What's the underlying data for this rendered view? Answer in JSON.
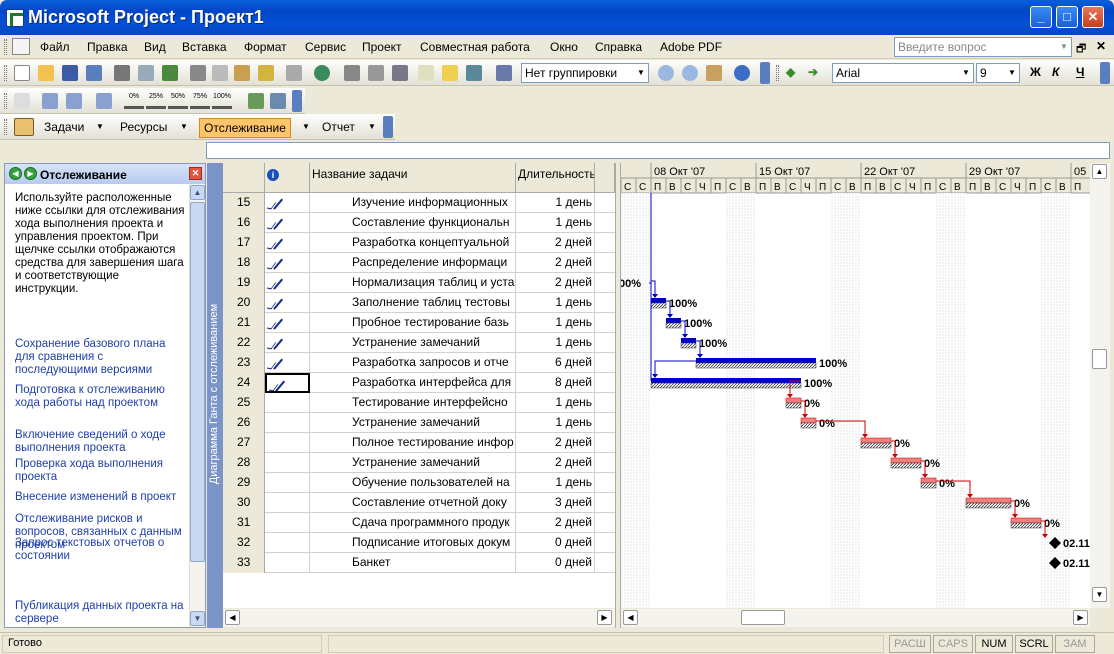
{
  "window": {
    "title": "Microsoft Project - Проект1"
  },
  "menu": {
    "items": [
      "Файл",
      "Правка",
      "Вид",
      "Вставка",
      "Формат",
      "Сервис",
      "Проект",
      "Совместная работа",
      "Окно",
      "Справка",
      "Adobe PDF"
    ],
    "help_placeholder": "Введите вопрос"
  },
  "toolbar": {
    "grouping": "Нет группировки",
    "font": "Arial",
    "font_size": "9",
    "bold": "Ж",
    "italic": "К",
    "underline": "Ч",
    "pct": [
      "0%",
      "25%",
      "50%",
      "75%",
      "100%"
    ]
  },
  "guide": {
    "tasks": "Задачи",
    "resources": "Ресурсы",
    "tracking": "Отслеживание",
    "report": "Отчет"
  },
  "taskpane": {
    "title": "Отслеживание",
    "description": "Используйте расположенные ниже ссылки для отслеживания хода выполнения проекта и управления проектом. При щелчке ссылки отображаются средства для завершения шага и соответствующие инструкции.",
    "links": [
      "Сохранение базового плана для сравнения с последующими версиями",
      "Подготовка к отслеживанию хода работы над проектом",
      "Включение сведений о ходе выполнения проекта",
      "Проверка хода выполнения проекта",
      "Внесение изменений в проект",
      "Отслеживание рисков и вопросов, связанных с данным проектом",
      "Запрос текстовых отчетов о состоянии",
      "Публикация данных проекта на сервере"
    ]
  },
  "view_label": "Диаграмма Ганта с отслеживанием",
  "table": {
    "headers": {
      "info": "i",
      "name": "Название задачи",
      "duration": "Длительность"
    },
    "rows": [
      {
        "id": "15",
        "done": true,
        "name": "Изучение информационных",
        "dur": "1 день"
      },
      {
        "id": "16",
        "done": true,
        "name": "Составление функциональн",
        "dur": "1 день"
      },
      {
        "id": "17",
        "done": true,
        "name": "Разработка концептуальной",
        "dur": "2 дней"
      },
      {
        "id": "18",
        "done": true,
        "name": "Распределение информаци",
        "dur": "2 дней"
      },
      {
        "id": "19",
        "done": true,
        "name": "Нормализация таблиц и уста",
        "dur": "2 дней"
      },
      {
        "id": "20",
        "done": true,
        "name": "Заполнение таблиц тестовы",
        "dur": "1 день"
      },
      {
        "id": "21",
        "done": true,
        "name": "Пробное тестирование базь",
        "dur": "1 день"
      },
      {
        "id": "22",
        "done": true,
        "name": "Устранение замечаний",
        "dur": "1 день"
      },
      {
        "id": "23",
        "done": true,
        "name": "Разработка запросов и отче",
        "dur": "6 дней"
      },
      {
        "id": "24",
        "done": true,
        "name": "Разработка интерфейса для",
        "dur": "8 дней"
      },
      {
        "id": "25",
        "done": false,
        "name": "Тестирование интерфейсно",
        "dur": "1 день"
      },
      {
        "id": "26",
        "done": false,
        "name": "Устранение замечаний",
        "dur": "1 день"
      },
      {
        "id": "27",
        "done": false,
        "name": "Полное тестирование инфор",
        "dur": "2 дней"
      },
      {
        "id": "28",
        "done": false,
        "name": "Устранение замечаний",
        "dur": "2 дней"
      },
      {
        "id": "29",
        "done": false,
        "name": "Обучение пользователей на",
        "dur": "1 день"
      },
      {
        "id": "30",
        "done": false,
        "name": "Составление отчетной доку",
        "dur": "3 дней"
      },
      {
        "id": "31",
        "done": false,
        "name": "Сдача программного продук",
        "dur": "2 дней"
      },
      {
        "id": "32",
        "done": false,
        "name": "Подписание итоговых докум",
        "dur": "0 дней"
      },
      {
        "id": "33",
        "done": false,
        "name": "Банкет",
        "dur": "0 дней"
      }
    ]
  },
  "gantt": {
    "weeks": [
      "08 Окт '07",
      "15 Окт '07",
      "22 Окт '07",
      "29 Окт '07",
      "05"
    ],
    "day_letters": [
      "С",
      "С",
      "П",
      "В",
      "С",
      "Ч",
      "П",
      "С",
      "В",
      "П",
      "В",
      "С",
      "Ч",
      "П",
      "С",
      "В",
      "П",
      "В",
      "С",
      "Ч",
      "П",
      "С",
      "В",
      "П",
      "В",
      "С",
      "Ч",
      "П",
      "С",
      "В",
      "П"
    ],
    "bars": [
      {
        "row": 4,
        "label": "00%"
      },
      {
        "row": 5,
        "label": "100%"
      },
      {
        "row": 6,
        "label": "100%"
      },
      {
        "row": 7,
        "label": "100%"
      },
      {
        "row": 8,
        "label": "100%"
      },
      {
        "row": 9,
        "label": "100%"
      },
      {
        "row": 10,
        "label": "0%"
      },
      {
        "row": 11,
        "label": "0%"
      },
      {
        "row": 12,
        "label": "0%"
      },
      {
        "row": 13,
        "label": "0%"
      },
      {
        "row": 14,
        "label": "0%"
      },
      {
        "row": 15,
        "label": "0%"
      },
      {
        "row": 16,
        "label": "0%"
      },
      {
        "row": 17,
        "label": "02.11"
      },
      {
        "row": 18,
        "label": "02.11"
      }
    ]
  },
  "status": {
    "ready": "Готово",
    "indicators": [
      {
        "t": "РАСШ",
        "on": false
      },
      {
        "t": "CAPS",
        "on": false
      },
      {
        "t": "NUM",
        "on": true
      },
      {
        "t": "SCRL",
        "on": true
      },
      {
        "t": "ЗАМ",
        "on": false
      }
    ]
  }
}
